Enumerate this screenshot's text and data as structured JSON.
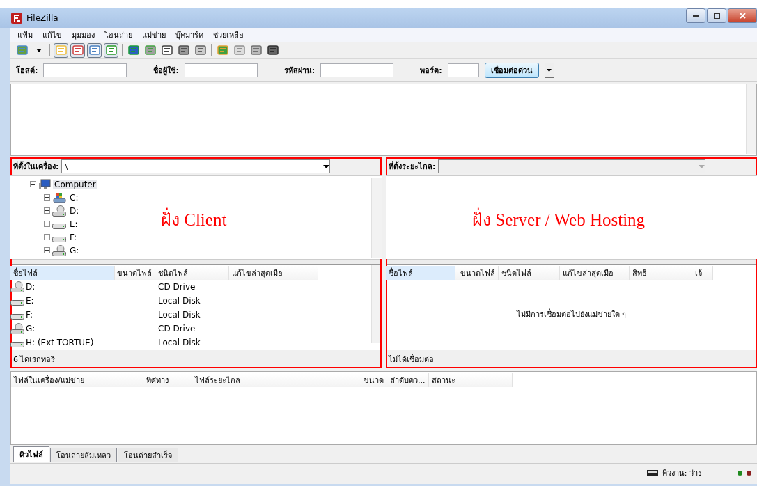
{
  "window": {
    "title": "FileZilla"
  },
  "menu": [
    "แฟ้ม",
    "แก้ไข",
    "มุมมอง",
    "โอนถ่าย",
    "แม่ข่าย",
    "บุ๊คมาร์ค",
    "ช่วยเหลือ"
  ],
  "toolbar": [
    {
      "kind": "sitemanager",
      "pressed": false
    },
    {
      "kind": "dropdown",
      "pressed": false
    },
    {
      "kind": "sep"
    },
    {
      "kind": "log",
      "pressed": true
    },
    {
      "kind": "tree",
      "pressed": true
    },
    {
      "kind": "remotetree",
      "pressed": true
    },
    {
      "kind": "queue",
      "pressed": true
    },
    {
      "kind": "sep"
    },
    {
      "kind": "refresh",
      "pressed": false
    },
    {
      "kind": "process",
      "pressed": false
    },
    {
      "kind": "cancel",
      "pressed": false
    },
    {
      "kind": "disconnect",
      "pressed": false
    },
    {
      "kind": "reconnect",
      "pressed": false
    },
    {
      "kind": "sep"
    },
    {
      "kind": "filter",
      "pressed": false
    },
    {
      "kind": "compare",
      "pressed": false
    },
    {
      "kind": "sync",
      "pressed": false
    },
    {
      "kind": "find",
      "pressed": false
    }
  ],
  "quickconnect": {
    "fields": [
      {
        "label": "โฮสต์:"
      },
      {
        "label": "ชื่อผู้ใช้:"
      },
      {
        "label": "รหัสผ่าน:"
      },
      {
        "label": "พอร์ต:"
      }
    ],
    "button": "เชื่อมต่อด่วน"
  },
  "local": {
    "highlighted": true,
    "annotation": "ฝั่ง Client",
    "location_label": "ที่ตั้งในเครื่อง:",
    "location_value": "\\",
    "tree": [
      {
        "label": "Computer",
        "kind": "computer",
        "expanded": true,
        "selected": true,
        "children": [
          {
            "label": "C:",
            "kind": "system",
            "expanded": false,
            "selected": false
          },
          {
            "label": "D:",
            "kind": "cd",
            "expanded": false,
            "selected": false
          },
          {
            "label": "E:",
            "kind": "disk",
            "expanded": false,
            "selected": false
          },
          {
            "label": "F:",
            "kind": "disk",
            "expanded": false,
            "selected": false
          },
          {
            "label": "G:",
            "kind": "cd",
            "expanded": false,
            "selected": false
          }
        ]
      }
    ],
    "columns": [
      "ชื่อไฟล์",
      "ขนาดไฟล์",
      "ชนิดไฟล์",
      "แก้ไขล่าสุดเมื่อ"
    ],
    "rows": [
      {
        "name": "D:",
        "type": "CD Drive",
        "kind": "cd"
      },
      {
        "name": "E:",
        "type": "Local Disk",
        "kind": "disk"
      },
      {
        "name": "F:",
        "type": "Local Disk",
        "kind": "disk"
      },
      {
        "name": "G:",
        "type": "CD Drive",
        "kind": "cd"
      },
      {
        "name": "H: (Ext TORTUE)",
        "type": "Local Disk",
        "kind": "disk"
      }
    ],
    "status": "6 ไดเรกทอรี"
  },
  "remote": {
    "highlighted": true,
    "annotation": "ฝั่ง Server / Web Hosting",
    "location_label": "ที่ตั้งระยะไกล:",
    "columns": [
      "ชื่อไฟล์",
      "ขนาดไฟล์",
      "ชนิดไฟล์",
      "แก้ไขล่าสุดเมื่อ",
      "สิทธิ",
      "เจ้"
    ],
    "empty_message": "ไม่มีการเชื่อมต่อไปยังแม่ข่ายใด ๆ",
    "status": "ไม่ได้เชื่อมต่อ"
  },
  "queue": {
    "columns": [
      "ไฟล์ในเครื่อง/แม่ข่าย",
      "ทิศทาง",
      "ไฟล์ระยะไกล",
      "ขนาด",
      "ลำดับคว...",
      "สถานะ"
    ]
  },
  "tabs": [
    {
      "label": "คิวไฟล์",
      "selected": true
    },
    {
      "label": "โอนถ่ายล้มเหลว",
      "selected": false
    },
    {
      "label": "โอนถ่ายสำเร็จ",
      "selected": false
    }
  ],
  "status_bar": {
    "queue": "คิวงาน: ว่าง",
    "lights": [
      {
        "color": "#1f8a1f"
      },
      {
        "color": "#8a1f1f"
      }
    ]
  }
}
